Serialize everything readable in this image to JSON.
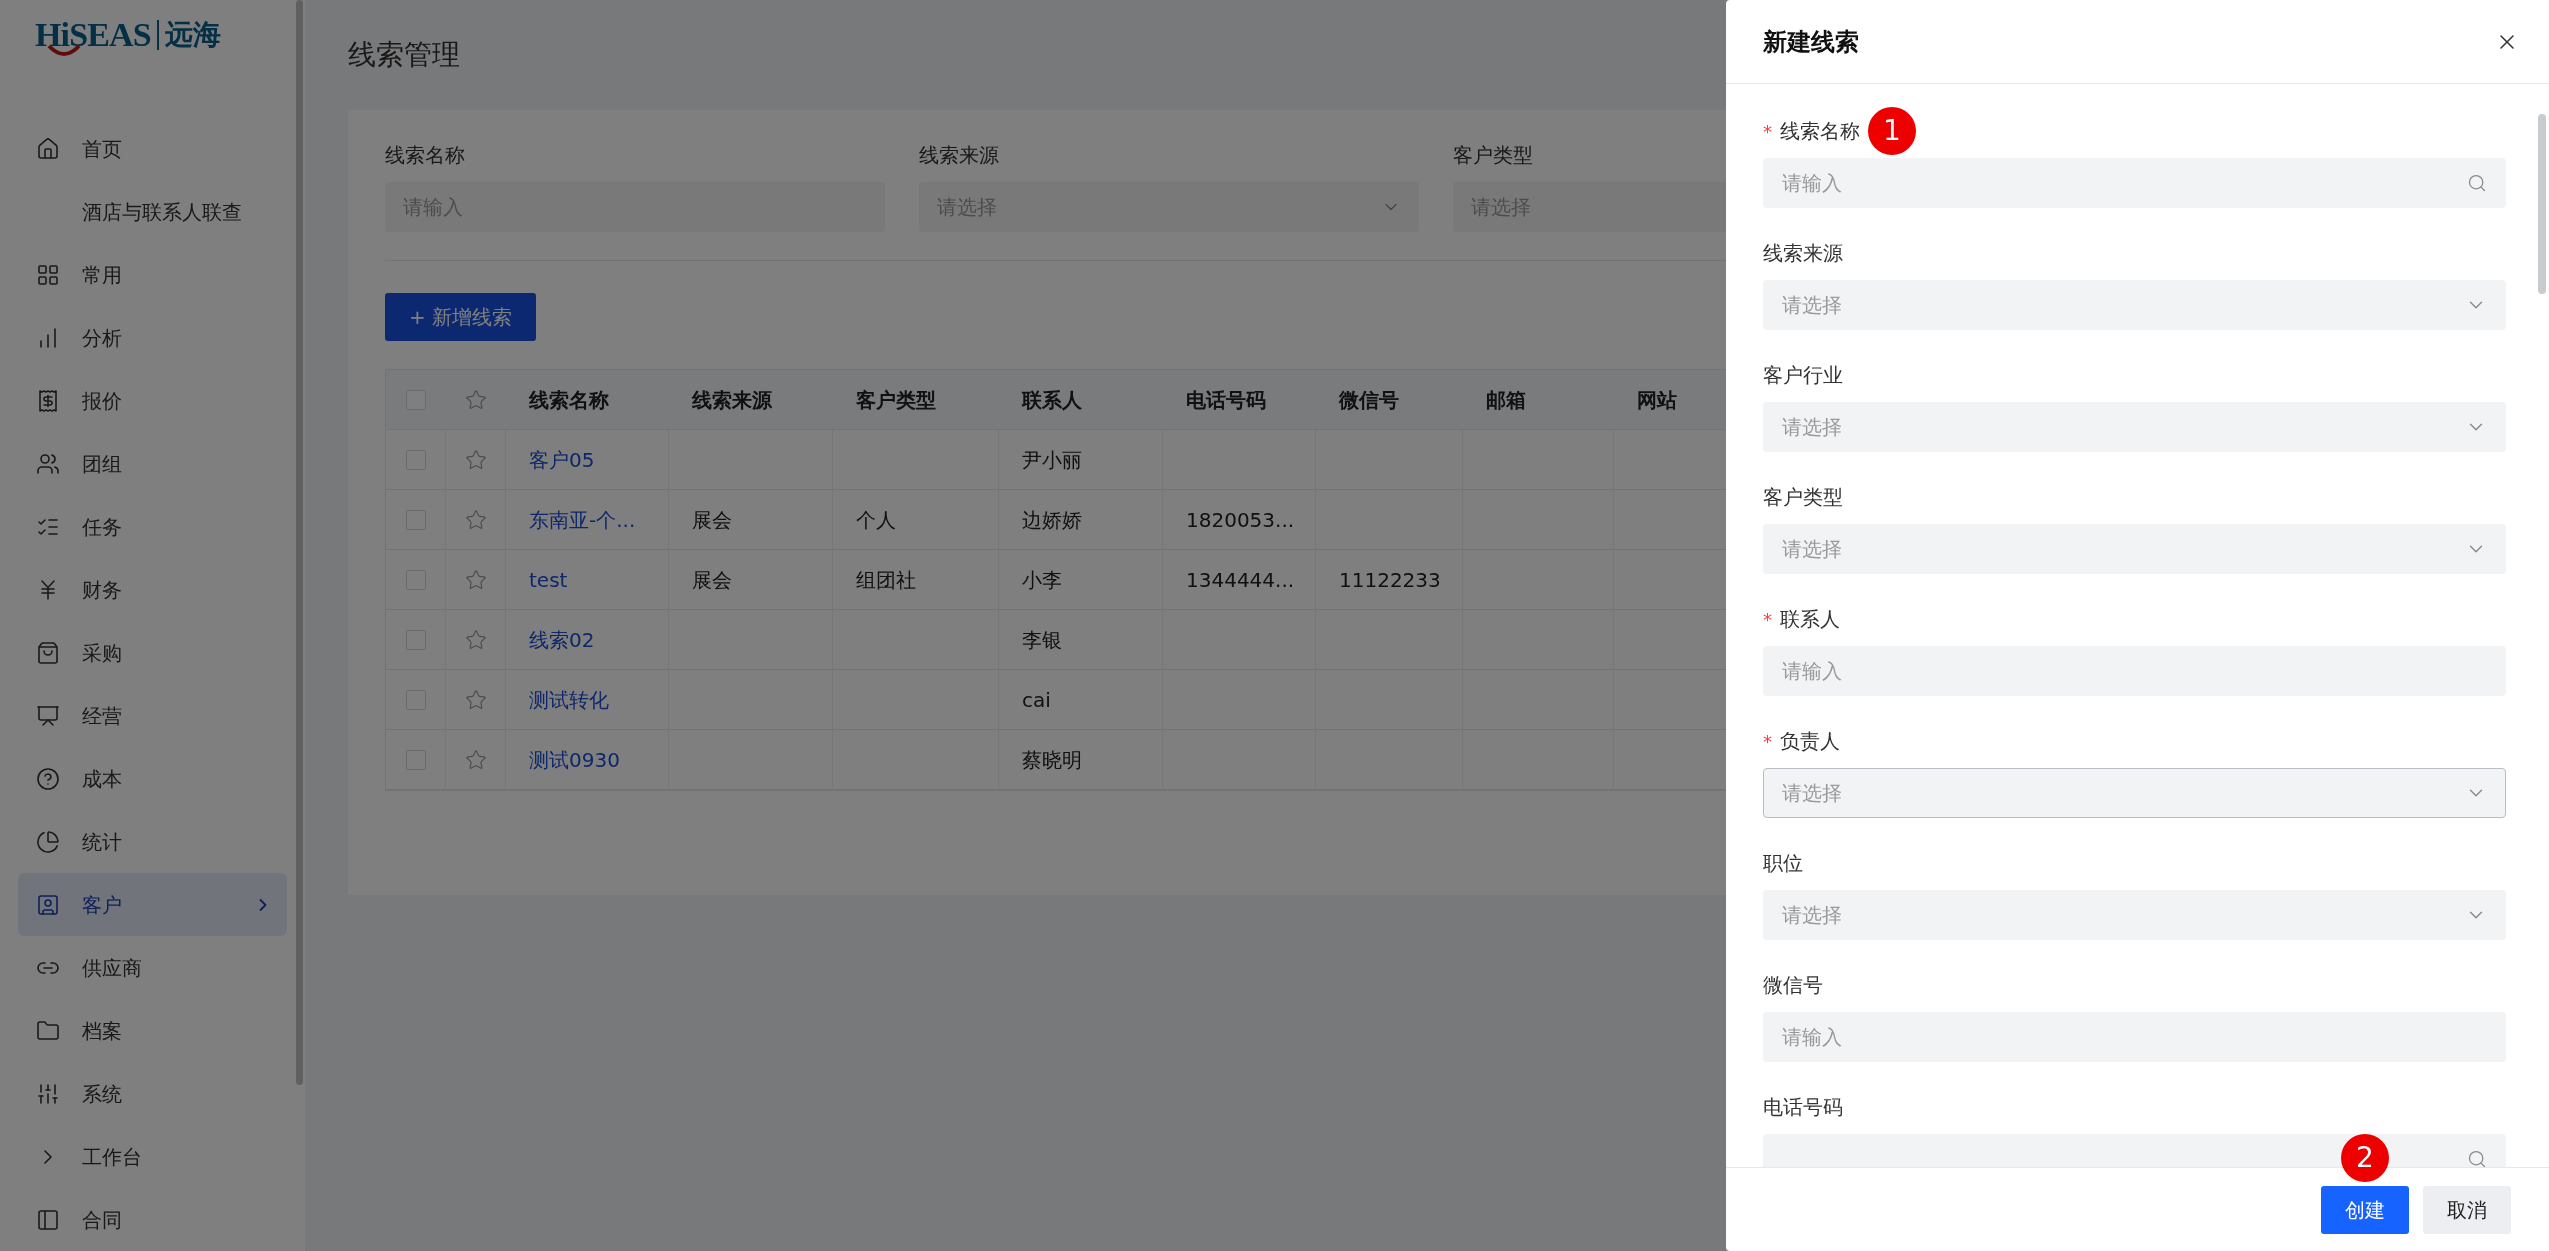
{
  "sidebar": {
    "logo": {
      "brand": "HiSEAS",
      "chinese": "远海"
    },
    "items": [
      {
        "label": "首页",
        "selected": false
      },
      {
        "label": "酒店与联系人联查",
        "selected": false
      },
      {
        "label": "常用",
        "selected": false
      },
      {
        "label": "分析",
        "selected": false
      },
      {
        "label": "报价",
        "selected": false
      },
      {
        "label": "团组",
        "selected": false
      },
      {
        "label": "任务",
        "selected": false
      },
      {
        "label": "财务",
        "selected": false
      },
      {
        "label": "采购",
        "selected": false
      },
      {
        "label": "经营",
        "selected": false
      },
      {
        "label": "成本",
        "selected": false
      },
      {
        "label": "统计",
        "selected": false
      },
      {
        "label": "客户",
        "selected": true
      },
      {
        "label": "供应商",
        "selected": false
      },
      {
        "label": "档案",
        "selected": false
      },
      {
        "label": "系统",
        "selected": false
      },
      {
        "label": "工作台",
        "selected": false
      },
      {
        "label": "合同",
        "selected": false
      }
    ]
  },
  "page": {
    "title": "线索管理"
  },
  "filters": [
    {
      "label": "线索名称",
      "placeholder": "请输入",
      "kind": "input"
    },
    {
      "label": "线索来源",
      "placeholder": "请选择",
      "kind": "select"
    },
    {
      "label": "客户类型",
      "placeholder": "请选择",
      "kind": "select"
    }
  ],
  "add_button": {
    "label": "+ 新增线索"
  },
  "table": {
    "header_checked": false,
    "columns": [
      "线索名称",
      "线索来源",
      "客户类型",
      "联系人",
      "电话号码",
      "微信号",
      "邮箱",
      "网站"
    ],
    "rows": [
      {
        "checked": false,
        "starred": false,
        "cells": [
          "客户05",
          "",
          "",
          "尹小丽",
          "",
          "",
          "",
          ""
        ]
      },
      {
        "checked": false,
        "starred": false,
        "cells": [
          "东南亚-个...",
          "展会",
          "个人",
          "边娇娇",
          "1820053...",
          "",
          "",
          ""
        ]
      },
      {
        "checked": false,
        "starred": false,
        "cells": [
          "test",
          "展会",
          "组团社",
          "小李",
          "1344444...",
          "11122233",
          "",
          ""
        ]
      },
      {
        "checked": false,
        "starred": false,
        "cells": [
          "线索02",
          "",
          "",
          "李银",
          "",
          "",
          "",
          ""
        ]
      },
      {
        "checked": false,
        "starred": false,
        "cells": [
          "测试转化",
          "",
          "",
          "cai",
          "",
          "",
          "",
          ""
        ]
      },
      {
        "checked": false,
        "starred": false,
        "cells": [
          "测试0930",
          "",
          "",
          "蔡晓明",
          "",
          "",
          "",
          ""
        ]
      }
    ]
  },
  "drawer": {
    "title": "新建线索",
    "fields": [
      {
        "label": "线索名称",
        "required_mark": "*",
        "placeholder": "请输入",
        "kind": "search",
        "highlighted": false,
        "annotation": "1"
      },
      {
        "label": "线索来源",
        "placeholder": "请选择",
        "kind": "select",
        "highlighted": false
      },
      {
        "label": "客户行业",
        "placeholder": "请选择",
        "kind": "select",
        "highlighted": false
      },
      {
        "label": "客户类型",
        "placeholder": "请选择",
        "kind": "select",
        "highlighted": false
      },
      {
        "label": "联系人",
        "required_mark": "*",
        "placeholder": "请输入",
        "kind": "input",
        "highlighted": false
      },
      {
        "label": "负责人",
        "required_mark": "*",
        "placeholder": "请选择",
        "kind": "select",
        "highlighted": true
      },
      {
        "label": "职位",
        "placeholder": "请选择",
        "kind": "select",
        "highlighted": false
      },
      {
        "label": "微信号",
        "placeholder": "请输入",
        "kind": "input",
        "highlighted": false
      },
      {
        "label": "电话号码",
        "kind": "search",
        "highlighted": false
      }
    ],
    "buttons": [
      {
        "label": "创建",
        "kind": "primary",
        "annotation": "2"
      },
      {
        "label": "取消",
        "kind": "secondary"
      }
    ]
  }
}
